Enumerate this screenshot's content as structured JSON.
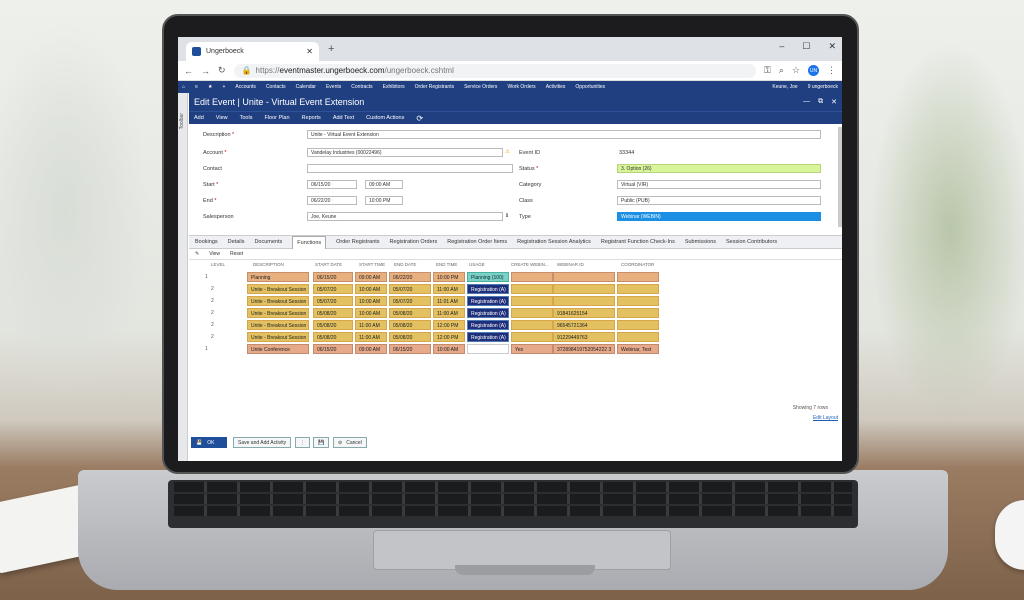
{
  "browser": {
    "tab_title": "Ungerboeck",
    "url_prefix": "https://",
    "url_host": "eventmaster.ungerboeck.com",
    "url_path": "/ungerboeck.cshtml",
    "avatar": "UN"
  },
  "app_nav": {
    "items": [
      "Accounts",
      "Contacts",
      "Calendar",
      "Events",
      "Contracts",
      "Exhibitors",
      "Order Registrants",
      "Service Orders",
      "Work Orders",
      "Activities",
      "Opportunities"
    ],
    "user": "Keune, Joe",
    "company": "9 ungerboeck"
  },
  "sidebar_label": "Toolbar",
  "page": {
    "title": "Edit Event | Unite - Virtual Event Extension"
  },
  "toolbar": [
    "Add",
    "View",
    "Tools",
    "Floor Plan",
    "Reports",
    "Add Text",
    "Custom Actions"
  ],
  "form": {
    "description_label": "Description",
    "description": "Unite - Virtual Event Extension",
    "account_label": "Account",
    "account": "Vandelay Industries (00022496)",
    "contact_label": "Contact",
    "start_label": "Start",
    "start_date": "06/15/20",
    "start_time": "09:00 AM",
    "end_label": "End",
    "end_date": "06/22/20",
    "end_time": "10:00 PM",
    "salesperson_label": "Salesperson",
    "salesperson": "Joe, Keune",
    "event_id_label": "Event ID",
    "event_id": "33344",
    "status_label": "Status",
    "status": "3. Option (26)",
    "category_label": "Category",
    "category": "Virtual (VIR)",
    "class_label": "Class",
    "class": "Public (PUB)",
    "type_label": "Type",
    "type": "Webinar (WEBIN)"
  },
  "subtabs": [
    "Bookings",
    "Details",
    "Documents",
    "Functions",
    "Order Registrants",
    "Registration Orders",
    "Registration Order Items",
    "Registration Session Analytics",
    "Registrant Function Check-Ins",
    "Submissions",
    "Session Contributors"
  ],
  "grid_toolbar": {
    "view": "View",
    "reset": "Reset"
  },
  "grid": {
    "headers": [
      "LEVEL",
      "DESCRIPTION",
      "START DATE",
      "START TIME",
      "END DATE",
      "END TIME",
      "USAGE",
      "CREATE WEBIN...",
      "WEBINAR ID",
      "COORDINATOR"
    ],
    "rows": [
      {
        "level": "1",
        "desc": "Planning",
        "sd": "06/15/20",
        "st": "09:00 AM",
        "ed": "06/22/20",
        "et": "10:00 PM",
        "usage": "Planning (100)",
        "cw": "",
        "wid": "",
        "coord": ""
      },
      {
        "level": "2",
        "desc": "Unite - Breakout Session 1",
        "sd": "05/07/20",
        "st": "10:00 AM",
        "ed": "05/07/20",
        "et": "11:00 AM",
        "usage": "Registration (A)",
        "cw": "",
        "wid": "",
        "coord": ""
      },
      {
        "level": "2",
        "desc": "Unite - Breakout Session 2",
        "sd": "05/07/20",
        "st": "10:00 AM",
        "ed": "05/07/20",
        "et": "11:01 AM",
        "usage": "Registration (A)",
        "cw": "",
        "wid": "",
        "coord": ""
      },
      {
        "level": "2",
        "desc": "Unite - Breakout Session 3",
        "sd": "05/08/20",
        "st": "10:00 AM",
        "ed": "05/08/20",
        "et": "11:00 AM",
        "usage": "Registration (A)",
        "cw": "",
        "wid": "91841625154",
        "coord": ""
      },
      {
        "level": "2",
        "desc": "Unite - Breakout Session 4",
        "sd": "05/08/20",
        "st": "11:00 AM",
        "ed": "05/08/20",
        "et": "12:00 PM",
        "usage": "Registration (A)",
        "cw": "",
        "wid": "96545721364",
        "coord": ""
      },
      {
        "level": "2",
        "desc": "Unite - Breakout Session 5",
        "sd": "05/08/20",
        "st": "11:00 AM",
        "ed": "05/08/20",
        "et": "12:00 PM",
        "usage": "Registration (A)",
        "cw": "",
        "wid": "91229449763",
        "coord": ""
      },
      {
        "level": "1",
        "desc": "Unite Conference",
        "sd": "06/15/20",
        "st": "09:00 AM",
        "ed": "06/15/20",
        "et": "10:00 AM",
        "usage": "",
        "cw": "Yes",
        "wid": "372898419752054222 3",
        "coord": "Webinar, Test"
      }
    ]
  },
  "footer": {
    "showing": "Showing 7 rows",
    "edit_layout": "Edit Layout",
    "ok": "OK",
    "save_add": "Save and Add Activity",
    "cancel": "Cancel"
  }
}
